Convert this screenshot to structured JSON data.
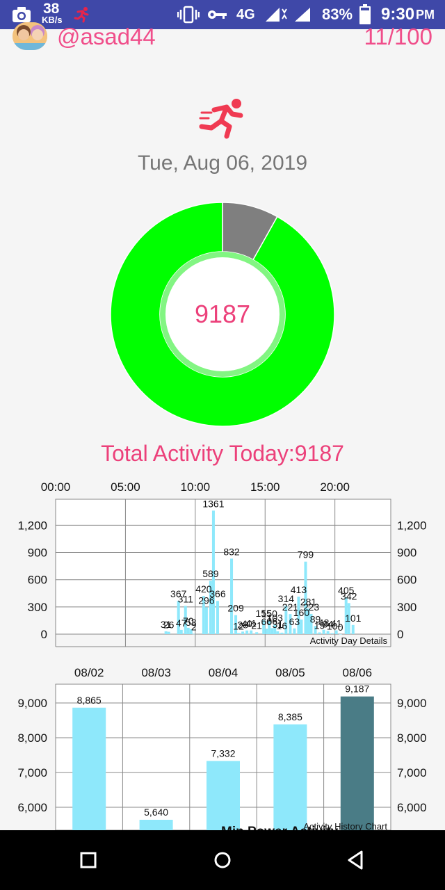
{
  "status_bar": {
    "speed_value": "38",
    "speed_unit": "KB/s",
    "network": "4G",
    "battery": "83%",
    "time": "9:30",
    "ampm": "PM",
    "icons": [
      "camera-icon",
      "runner-notification-icon",
      "vibrate-icon",
      "key-icon",
      "signal-icon",
      "battery-icon"
    ]
  },
  "header": {
    "username": "@asad44",
    "score": "11/100"
  },
  "main": {
    "activity_icon": "runner-icon",
    "date": "Tue, Aug 06, 2019",
    "total_value": "9187",
    "total_label": "Total Activity Today:9187"
  },
  "colors": {
    "accent": "#ec407a",
    "donut_green": "#00ff00",
    "donut_grey": "#7f7f7f",
    "bar": "#8ee8fb",
    "bar_selected": "#4a7c86",
    "status_bar": "#3f48a8"
  },
  "chart_data": [
    {
      "type": "pie",
      "description_hidden": true,
      "values": [
        9187,
        813
      ],
      "center_label": "9187"
    },
    {
      "type": "bar",
      "description": "Activity Day Details",
      "x_tick_labels": [
        "00:00",
        "05:00",
        "10:00",
        "15:00",
        "20:00"
      ],
      "y_tick_labels": [
        "0",
        "300",
        "600",
        "900",
        "1,200"
      ],
      "ylim": [
        0,
        1500
      ],
      "xlim_hours": [
        0,
        24
      ],
      "bars": [
        {
          "x": 7.8,
          "y": 31,
          "label": "31"
        },
        {
          "x": 8.0,
          "y": 26,
          "label": "26"
        },
        {
          "x": 8.7,
          "y": 367,
          "label": "367"
        },
        {
          "x": 8.9,
          "y": 47,
          "label": "47"
        },
        {
          "x": 9.2,
          "y": 311,
          "label": "311"
        },
        {
          "x": 9.4,
          "y": 70,
          "label": "70"
        },
        {
          "x": 9.6,
          "y": 53,
          "label": "53"
        },
        {
          "x": 9.8,
          "y": 2,
          "label": "2"
        },
        {
          "x": 10.5,
          "y": 420,
          "label": "420"
        },
        {
          "x": 10.7,
          "y": 296,
          "label": "296"
        },
        {
          "x": 11.0,
          "y": 589,
          "label": "589"
        },
        {
          "x": 11.2,
          "y": 1361,
          "label": "1361"
        },
        {
          "x": 11.5,
          "y": 366,
          "label": "366"
        },
        {
          "x": 12.5,
          "y": 832,
          "label": "832"
        },
        {
          "x": 12.8,
          "y": 209,
          "label": "209"
        },
        {
          "x": 13.0,
          "y": 12,
          "label": "12"
        },
        {
          "x": 13.3,
          "y": 28,
          "label": "28"
        },
        {
          "x": 13.6,
          "y": 40,
          "label": "40"
        },
        {
          "x": 13.9,
          "y": 41,
          "label": "41"
        },
        {
          "x": 14.3,
          "y": 21,
          "label": "21"
        },
        {
          "x": 14.8,
          "y": 155,
          "label": "155"
        },
        {
          "x": 15.0,
          "y": 60,
          "label": "60"
        },
        {
          "x": 15.2,
          "y": 150,
          "label": "150"
        },
        {
          "x": 15.4,
          "y": 66,
          "label": "66"
        },
        {
          "x": 15.6,
          "y": 103,
          "label": "103"
        },
        {
          "x": 15.8,
          "y": 31,
          "label": "31"
        },
        {
          "x": 16.1,
          "y": 16,
          "label": "16"
        },
        {
          "x": 16.4,
          "y": 314,
          "label": "314"
        },
        {
          "x": 16.7,
          "y": 221,
          "label": "221"
        },
        {
          "x": 17.0,
          "y": 63,
          "label": "63"
        },
        {
          "x": 17.3,
          "y": 413,
          "label": "413"
        },
        {
          "x": 17.5,
          "y": 160,
          "label": "160"
        },
        {
          "x": 17.8,
          "y": 799,
          "label": "799"
        },
        {
          "x": 18.0,
          "y": 281,
          "label": "281"
        },
        {
          "x": 18.2,
          "y": 223,
          "label": "223"
        },
        {
          "x": 18.5,
          "y": 89,
          "label": "89"
        },
        {
          "x": 18.8,
          "y": 19,
          "label": "19"
        },
        {
          "x": 19.1,
          "y": 48,
          "label": "48"
        },
        {
          "x": 19.4,
          "y": 34,
          "label": "34"
        },
        {
          "x": 19.7,
          "y": 10,
          "label": "10"
        },
        {
          "x": 20.0,
          "y": 41,
          "label": "41"
        },
        {
          "x": 20.3,
          "y": 0,
          "label": "0"
        },
        {
          "x": 20.7,
          "y": 405,
          "label": "405"
        },
        {
          "x": 20.9,
          "y": 342,
          "label": "342"
        },
        {
          "x": 21.2,
          "y": 101,
          "label": "101"
        }
      ]
    },
    {
      "type": "bar",
      "description": "Activity History Chart",
      "categories": [
        "08/02",
        "08/03",
        "08/04",
        "08/05",
        "08/06"
      ],
      "values": [
        8865,
        5640,
        7332,
        8385,
        9187
      ],
      "value_labels": [
        "8,865",
        "5,640",
        "7,332",
        "8,385",
        "9,187"
      ],
      "y_tick_labels": [
        "6,000",
        "7,000",
        "8,000",
        "9,000"
      ],
      "ylim": [
        5300,
        9500
      ],
      "selected_index": 4,
      "overlay_text": "Min Power Activity"
    }
  ],
  "nav_bar": {
    "buttons": [
      "recents-square-icon",
      "home-circle-icon",
      "back-triangle-icon"
    ]
  }
}
